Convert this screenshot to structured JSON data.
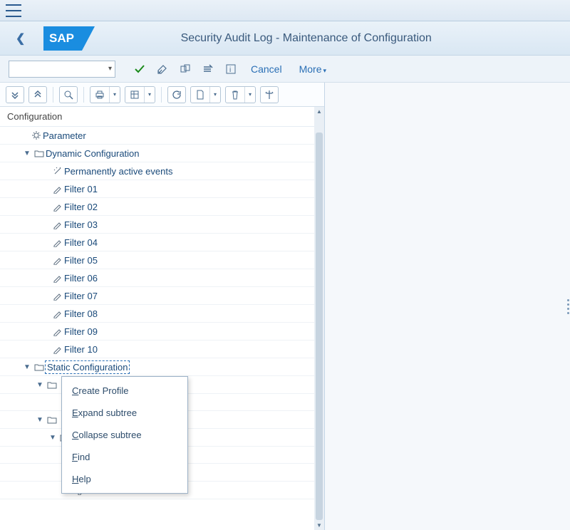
{
  "header": {
    "title": "Security Audit Log - Maintenance of Configuration"
  },
  "toolbar1": {
    "cancel": "Cancel",
    "more": "More"
  },
  "tree": {
    "head": "Configuration",
    "parameter": "Parameter",
    "dynamic": "Dynamic Configuration",
    "permActive": "Permanently active events",
    "filters": [
      "Filter 01",
      "Filter 02",
      "Filter 03",
      "Filter 04",
      "Filter 05",
      "Filter 06",
      "Filter 07",
      "Filter 08",
      "Filter 09",
      "Filter 10"
    ],
    "static": "Static Configuration",
    "partialFilter": "Filter 01"
  },
  "contextMenu": {
    "createProfile_pre": "C",
    "createProfile_post": "reate Profile",
    "expand_pre": "E",
    "expand_post": "xpand subtree",
    "collapse_pre": "C",
    "collapse_post": "ollapse subtree",
    "find_pre": "F",
    "find_post": "ind",
    "help_pre": "H",
    "help_post": "elp"
  }
}
